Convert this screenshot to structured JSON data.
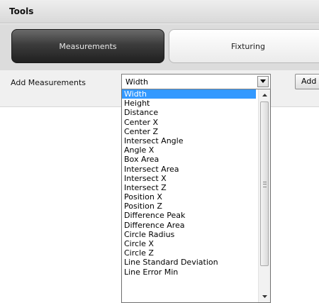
{
  "header": {
    "title": "Tools"
  },
  "tabs": [
    {
      "label": "Measurements",
      "active": true
    },
    {
      "label": "Fixturing",
      "active": false
    }
  ],
  "add_measurements": {
    "label": "Add Measurements",
    "selected_value": "Width",
    "add_button_label": "Add"
  },
  "dropdown": {
    "items": [
      "Width",
      "Height",
      "Distance",
      "Center X",
      "Center Z",
      "Intersect Angle",
      "Angle X",
      "Box Area",
      "Intersect Area",
      "Intersect X",
      "Intersect Z",
      "Position X",
      "Position Z",
      "Difference Peak",
      "Difference Area",
      "Circle Radius",
      "Circle X",
      "Circle Z",
      "Line Standard Deviation",
      "Line Error Min"
    ],
    "highlighted_index": 0
  },
  "colors": {
    "selection": "#3399ff",
    "active_tab_dark": "#202020",
    "panel_bg": "#f0f0f0"
  },
  "icons": {
    "combo_arrow": "chevron-down-icon",
    "scroll_up": "scroll-up-arrow-icon",
    "scroll_down": "scroll-down-arrow-icon"
  }
}
